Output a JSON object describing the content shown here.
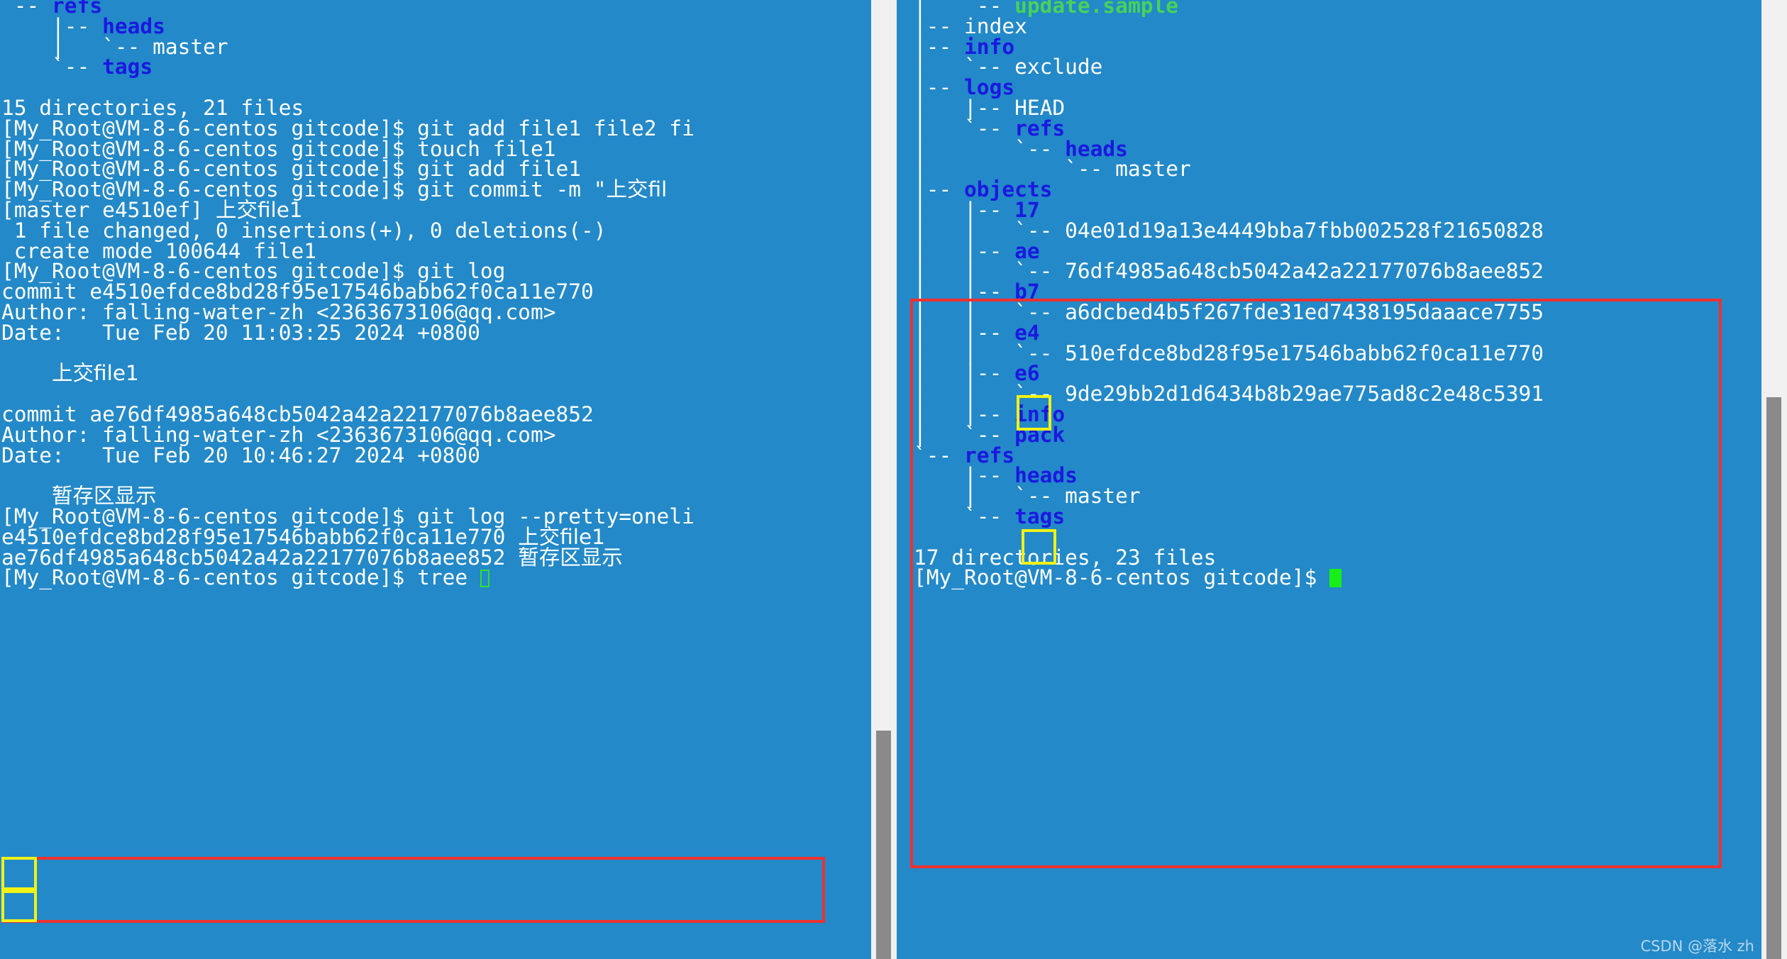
{
  "terminal": {
    "background_color": "#2389c8",
    "foreground_color": "#ffffff",
    "dir_color": "#1b18e0",
    "exec_color": "#46d25a",
    "prompt": "[My_Root@VM-8-6-centos gitcode]$ ",
    "cursor_color": "#18ee18"
  },
  "annotations": {
    "red_box_color": "#f03030",
    "yellow_box_color": "#f2f216"
  },
  "watermark": {
    "text": "CSDN @落水 zh"
  },
  "left_pane": {
    "lines": [
      {
        "segs": [
          {
            "t": "`-- ",
            "c": "plain"
          },
          {
            "t": "refs",
            "c": "dir"
          }
        ]
      },
      {
        "segs": [
          {
            "t": "    |-- ",
            "c": "plain"
          },
          {
            "t": "heads",
            "c": "dir"
          }
        ]
      },
      {
        "segs": [
          {
            "t": "    |   `-- master",
            "c": "plain"
          }
        ]
      },
      {
        "segs": [
          {
            "t": "    `-- ",
            "c": "plain"
          },
          {
            "t": "tags",
            "c": "dir"
          }
        ]
      },
      {
        "segs": [
          {
            "t": "",
            "c": "plain"
          }
        ]
      },
      {
        "segs": [
          {
            "t": "15 directories, 21 files",
            "c": "plain"
          }
        ]
      },
      {
        "segs": [
          {
            "t": "[My_Root@VM-8-6-centos gitcode]$ git add file1 file2 fi",
            "c": "plain"
          }
        ]
      },
      {
        "segs": [
          {
            "t": "[My_Root@VM-8-6-centos gitcode]$ touch file1",
            "c": "plain"
          }
        ]
      },
      {
        "segs": [
          {
            "t": "[My_Root@VM-8-6-centos gitcode]$ git add file1",
            "c": "plain"
          }
        ]
      },
      {
        "segs": [
          {
            "t": "[My_Root@VM-8-6-centos gitcode]$ git commit -m \"",
            "c": "plain"
          },
          {
            "t": "上交fil",
            "c": "cjk"
          }
        ]
      },
      {
        "segs": [
          {
            "t": "[master e4510ef] ",
            "c": "plain"
          },
          {
            "t": "上交file1",
            "c": "cjk"
          }
        ]
      },
      {
        "segs": [
          {
            "t": " 1 file changed, 0 insertions(+), 0 deletions(-)",
            "c": "plain"
          }
        ]
      },
      {
        "segs": [
          {
            "t": " create mode 100644 file1",
            "c": "plain"
          }
        ]
      },
      {
        "segs": [
          {
            "t": "[My_Root@VM-8-6-centos gitcode]$ git log",
            "c": "plain"
          }
        ]
      },
      {
        "segs": [
          {
            "t": "commit e4510efdce8bd28f95e17546babb62f0ca11e770",
            "c": "plain"
          }
        ]
      },
      {
        "segs": [
          {
            "t": "Author: falling-water-zh <2363673106@qq.com>",
            "c": "plain"
          }
        ]
      },
      {
        "segs": [
          {
            "t": "Date:   Tue Feb 20 11:03:25 2024 +0800",
            "c": "plain"
          }
        ]
      },
      {
        "segs": [
          {
            "t": "",
            "c": "plain"
          }
        ]
      },
      {
        "segs": [
          {
            "t": "    ",
            "c": "plain"
          },
          {
            "t": "上交file1",
            "c": "cjk"
          }
        ]
      },
      {
        "segs": [
          {
            "t": "",
            "c": "plain"
          }
        ]
      },
      {
        "segs": [
          {
            "t": "commit ae76df4985a648cb5042a42a22177076b8aee852",
            "c": "plain"
          }
        ]
      },
      {
        "segs": [
          {
            "t": "Author: falling-water-zh <2363673106@qq.com>",
            "c": "plain"
          }
        ]
      },
      {
        "segs": [
          {
            "t": "Date:   Tue Feb 20 10:46:27 2024 +0800",
            "c": "plain"
          }
        ]
      },
      {
        "segs": [
          {
            "t": "",
            "c": "plain"
          }
        ]
      },
      {
        "segs": [
          {
            "t": "    ",
            "c": "plain"
          },
          {
            "t": "暂存区显示",
            "c": "cjk"
          }
        ]
      },
      {
        "segs": [
          {
            "t": "[My_Root@VM-8-6-centos gitcode]$ git log --pretty=oneli",
            "c": "plain"
          }
        ]
      },
      {
        "segs": [
          {
            "t": "e4510efdce8bd28f95e17546babb62f0ca11e770 ",
            "c": "plain"
          },
          {
            "t": "上交file1",
            "c": "cjk"
          }
        ]
      },
      {
        "segs": [
          {
            "t": "ae76df4985a648cb5042a42a22177076b8aee852 ",
            "c": "plain"
          },
          {
            "t": "暂存区显示",
            "c": "cjk"
          }
        ]
      },
      {
        "segs": [
          {
            "t": "[My_Root@VM-8-6-centos gitcode]$ tree ",
            "c": "plain"
          },
          {
            "t": "▯",
            "c": "cursor-hollow"
          }
        ]
      }
    ]
  },
  "right_pane": {
    "lines": [
      {
        "segs": [
          {
            "t": "|   `-- ",
            "c": "plain"
          },
          {
            "t": "update.sample",
            "c": "exec"
          }
        ]
      },
      {
        "segs": [
          {
            "t": "|-- index",
            "c": "plain"
          }
        ]
      },
      {
        "segs": [
          {
            "t": "|-- ",
            "c": "plain"
          },
          {
            "t": "info",
            "c": "dir"
          }
        ]
      },
      {
        "segs": [
          {
            "t": "|   `-- exclude",
            "c": "plain"
          }
        ]
      },
      {
        "segs": [
          {
            "t": "|-- ",
            "c": "plain"
          },
          {
            "t": "logs",
            "c": "dir"
          }
        ]
      },
      {
        "segs": [
          {
            "t": "|   |-- HEAD",
            "c": "plain"
          }
        ]
      },
      {
        "segs": [
          {
            "t": "|   `-- ",
            "c": "plain"
          },
          {
            "t": "refs",
            "c": "dir"
          }
        ]
      },
      {
        "segs": [
          {
            "t": "|       `-- ",
            "c": "plain"
          },
          {
            "t": "heads",
            "c": "dir"
          }
        ]
      },
      {
        "segs": [
          {
            "t": "|           `-- master",
            "c": "plain"
          }
        ]
      },
      {
        "segs": [
          {
            "t": "|-- ",
            "c": "plain"
          },
          {
            "t": "objects",
            "c": "dir"
          }
        ]
      },
      {
        "segs": [
          {
            "t": "|   |-- ",
            "c": "plain"
          },
          {
            "t": "17",
            "c": "dir"
          }
        ]
      },
      {
        "segs": [
          {
            "t": "|   |   `-- 04e01d19a13e4449bba7fbb002528f21650828",
            "c": "plain"
          }
        ]
      },
      {
        "segs": [
          {
            "t": "|   |-- ",
            "c": "plain"
          },
          {
            "t": "ae",
            "c": "dir"
          }
        ]
      },
      {
        "segs": [
          {
            "t": "|   |   `-- 76df4985a648cb5042a42a22177076b8aee852",
            "c": "plain"
          }
        ]
      },
      {
        "segs": [
          {
            "t": "|   |-- ",
            "c": "plain"
          },
          {
            "t": "b7",
            "c": "dir"
          }
        ]
      },
      {
        "segs": [
          {
            "t": "|   |   `-- a6dcbed4b5f267fde31ed7438195daaace7755",
            "c": "plain"
          }
        ]
      },
      {
        "segs": [
          {
            "t": "|   |-- ",
            "c": "plain"
          },
          {
            "t": "e4",
            "c": "dir"
          }
        ]
      },
      {
        "segs": [
          {
            "t": "|   |   `-- 510efdce8bd28f95e17546babb62f0ca11e770",
            "c": "plain"
          }
        ]
      },
      {
        "segs": [
          {
            "t": "|   |-- ",
            "c": "plain"
          },
          {
            "t": "e6",
            "c": "dir"
          }
        ]
      },
      {
        "segs": [
          {
            "t": "|   |   `-- 9de29bb2d1d6434b8b29ae775ad8c2e48c5391",
            "c": "plain"
          }
        ]
      },
      {
        "segs": [
          {
            "t": "|   |-- ",
            "c": "plain"
          },
          {
            "t": "info",
            "c": "dir"
          }
        ]
      },
      {
        "segs": [
          {
            "t": "|   `-- ",
            "c": "plain"
          },
          {
            "t": "pack",
            "c": "dir"
          }
        ]
      },
      {
        "segs": [
          {
            "t": "`-- ",
            "c": "plain"
          },
          {
            "t": "refs",
            "c": "dir"
          }
        ]
      },
      {
        "segs": [
          {
            "t": "    |-- ",
            "c": "plain"
          },
          {
            "t": "heads",
            "c": "dir"
          }
        ]
      },
      {
        "segs": [
          {
            "t": "    |   `-- master",
            "c": "plain"
          }
        ]
      },
      {
        "segs": [
          {
            "t": "    `-- ",
            "c": "plain"
          },
          {
            "t": "tags",
            "c": "dir"
          }
        ]
      },
      {
        "segs": [
          {
            "t": "",
            "c": "plain"
          }
        ]
      },
      {
        "segs": [
          {
            "t": "17 directories, 23 files",
            "c": "plain"
          }
        ]
      },
      {
        "segs": [
          {
            "t": "[My_Root@VM-8-6-centos gitcode]$ ",
            "c": "plain"
          },
          {
            "t": "█",
            "c": "cursor-solid"
          }
        ]
      }
    ]
  }
}
